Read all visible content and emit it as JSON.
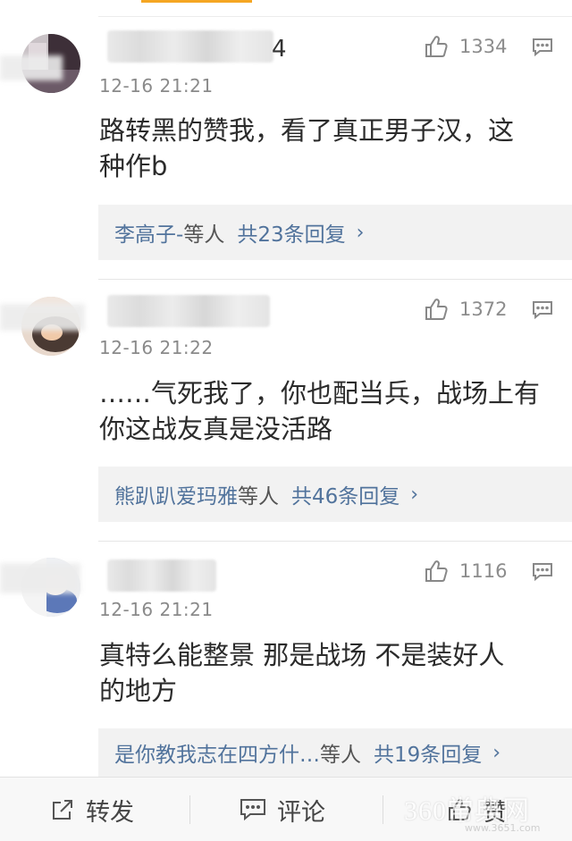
{
  "comments": [
    {
      "name_visible": "4",
      "time": "12-16 21:21",
      "likes": "1334",
      "text_line1": "路转黑的赞我，看了真正男子汉，这",
      "text_line2": "种作b",
      "reply_names": "李高子-",
      "reply_suffix": "等人",
      "reply_total": "共23条回复",
      "reply_chevron": "›"
    },
    {
      "time": "12-16 21:22",
      "likes": "1372",
      "text_line1": "……气死我了，你也配当兵，战场上有",
      "text_line2": "你这战友真是没活路",
      "reply_names": "熊趴趴爱玛雅",
      "reply_suffix": "等人",
      "reply_total": "共46条回复",
      "reply_chevron": "›"
    },
    {
      "time": "12-16 21:21",
      "likes": "1116",
      "text_line1": "真特么能整景 那是战场 不是装好人",
      "text_line2": "的地方",
      "reply_names": "是你教我志在四方什…",
      "reply_suffix": "等人",
      "reply_total": "共19条回复",
      "reply_chevron": "›"
    }
  ],
  "bottom_bar": {
    "repost_label": "转发",
    "comment_label": "评论",
    "like_label": "赞"
  },
  "watermark": {
    "text": "360常典网",
    "sub": "www.3651.com"
  },
  "colors": {
    "accent": "#f5a623",
    "link": "#51739c",
    "reply_bg": "#f2f2f2"
  },
  "icons": [
    "thumbs-up-icon",
    "reply-bubble-icon",
    "share-icon",
    "comment-icon",
    "like-icon"
  ]
}
